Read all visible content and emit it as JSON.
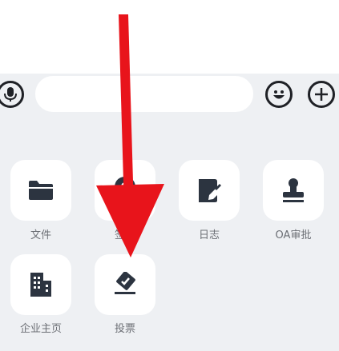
{
  "input_bar": {
    "text": ""
  },
  "panel": {
    "items": [
      {
        "label": "文件",
        "icon": "folder-icon"
      },
      {
        "label": "签到",
        "icon": "location-pin-icon"
      },
      {
        "label": "日志",
        "icon": "journal-edit-icon"
      },
      {
        "label": "OA审批",
        "icon": "stamp-icon"
      },
      {
        "label": "企业主页",
        "icon": "building-icon"
      },
      {
        "label": "投票",
        "icon": "vote-ballot-icon"
      }
    ]
  },
  "colors": {
    "panel_bg": "#eef0f3",
    "icon": "#2c3440",
    "label": "#6c6f75",
    "arrow": "#e8141b"
  }
}
